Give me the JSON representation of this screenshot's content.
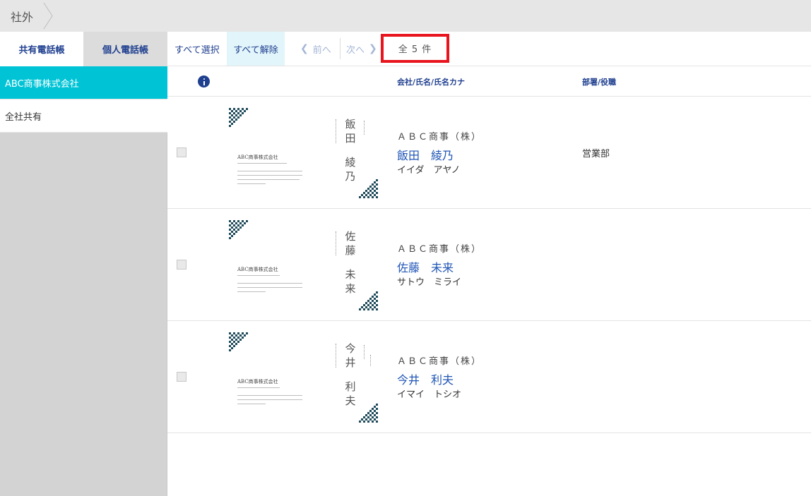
{
  "breadcrumb": {
    "current": "社外"
  },
  "left_tabs": [
    {
      "label": "共有電話帳",
      "active": true
    },
    {
      "label": "個人電話帳",
      "active": false
    }
  ],
  "groups": [
    {
      "label": "ABC商事株式会社",
      "selected": true
    },
    {
      "label": "全社共有",
      "selected": false
    }
  ],
  "toolbar": {
    "select_all": "すべて選択",
    "clear_all": "すべて解除",
    "prev": "前へ",
    "next": "次へ",
    "total": "全 5 件"
  },
  "table_header": {
    "name_column": "会社/氏名/氏名カナ",
    "dept_column": "部署/役職"
  },
  "contacts": [
    {
      "company": "ＡＢＣ商事（株）",
      "name": "飯田　綾乃",
      "kana": "イイダ　アヤノ",
      "department": "営業部",
      "card_company": "ABC商事株式会社",
      "card_name_chars": [
        "飯",
        "田",
        "",
        "綾",
        "乃"
      ]
    },
    {
      "company": "ＡＢＣ商事（株）",
      "name": "佐藤　未来",
      "kana": "サトウ　ミライ",
      "department": "",
      "card_company": "ABC商事株式会社",
      "card_name_chars": [
        "佐",
        "藤",
        "",
        "未",
        "来"
      ]
    },
    {
      "company": "ＡＢＣ商事（株）",
      "name": "今井　利夫",
      "kana": "イマイ　トシオ",
      "department": "",
      "card_company": "ABC商事株式会社",
      "card_name_chars": [
        "今",
        "井",
        "",
        "利",
        "夫"
      ]
    }
  ],
  "colors": {
    "accent_cyan": "#00c4d6",
    "link_blue": "#1f55b5",
    "header_navy": "#1f3f8f",
    "highlight_red": "#e8141e",
    "card_pattern": "#1e4a5a"
  },
  "icons": {
    "info": "info-circle-icon",
    "prev": "chevron-left-icon",
    "next": "chevron-right-icon"
  }
}
